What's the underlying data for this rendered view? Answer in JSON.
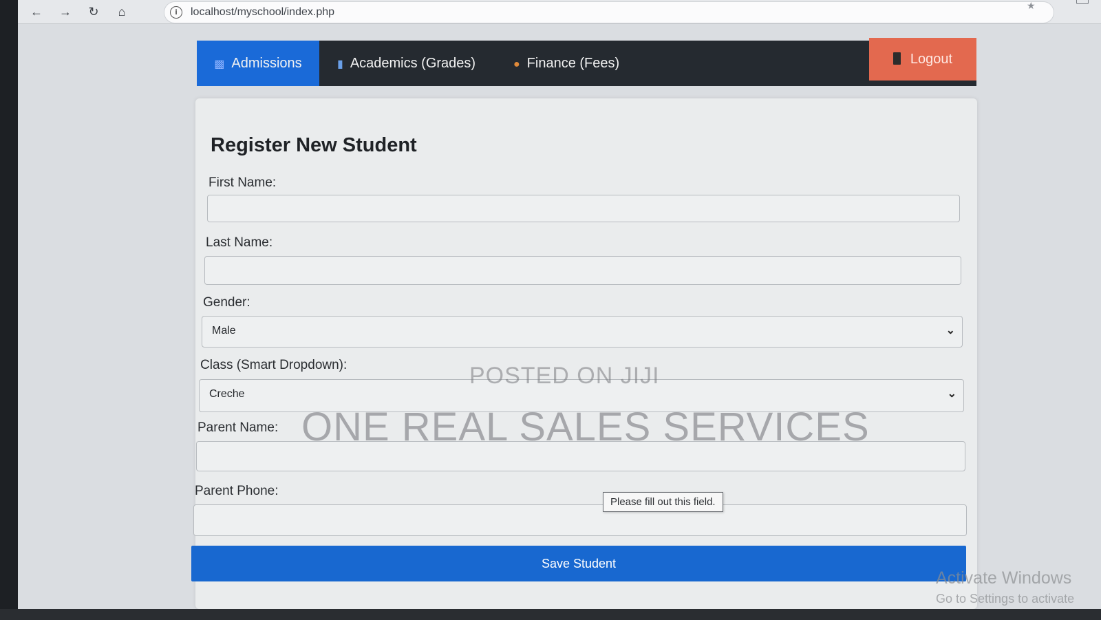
{
  "browser": {
    "url": "localhost/myschool/index.php"
  },
  "nav": {
    "items": [
      {
        "label": "Admissions",
        "icon": "document-icon",
        "active": true
      },
      {
        "label": "Academics (Grades)",
        "icon": "books-icon",
        "active": false
      },
      {
        "label": "Finance (Fees)",
        "icon": "money-bag-icon",
        "active": false
      }
    ],
    "logout_label": "Logout"
  },
  "form": {
    "title": "Register New Student",
    "first_name_label": "First Name:",
    "first_name_value": "",
    "last_name_label": "Last Name:",
    "last_name_value": "",
    "gender_label": "Gender:",
    "gender_value": "Male",
    "class_label": "Class (Smart Dropdown):",
    "class_value": "Creche",
    "parent_name_label": "Parent Name:",
    "parent_name_value": "",
    "parent_phone_label": "Parent Phone:",
    "parent_phone_value": "",
    "save_label": "Save Student",
    "validation_tooltip": "Please fill out this field."
  },
  "overlays": {
    "watermark_small": "POSTED ON JIJI",
    "watermark_large": "ONE REAL SALES SERVICES",
    "activate_line1": "Activate Windows",
    "activate_line2": "Go to Settings to activate"
  },
  "colors": {
    "accent": "#1a6ad8",
    "nav_bg": "#252a30",
    "logout": "#e3694f"
  }
}
